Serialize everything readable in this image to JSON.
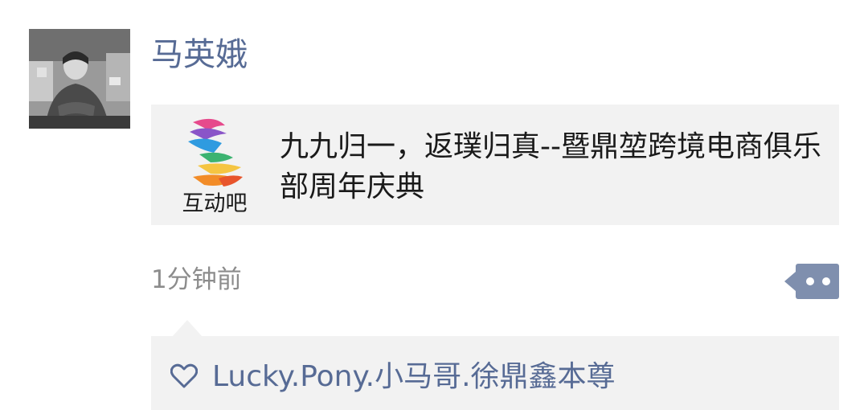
{
  "post": {
    "author_name": "马英娥",
    "avatar_icon": "avatar-photo-icon",
    "link": {
      "logo_icon": "hudongba-logo-icon",
      "logo_text": "互动吧",
      "title": "九九归一，返璞归真--暨鼎堃跨境电商俱乐部周年庆典"
    },
    "timestamp": "1分钟前",
    "more_icon": "more-dots-icon",
    "likes": {
      "icon": "heart-icon",
      "names": "Lucky.Pony.小马哥.徐鼎鑫本尊"
    }
  },
  "colors": {
    "name_link": "#576b95",
    "card_bg": "#f2f2f2",
    "meta_gray": "#8c8c8c",
    "text_dark": "#1a1a1a"
  }
}
